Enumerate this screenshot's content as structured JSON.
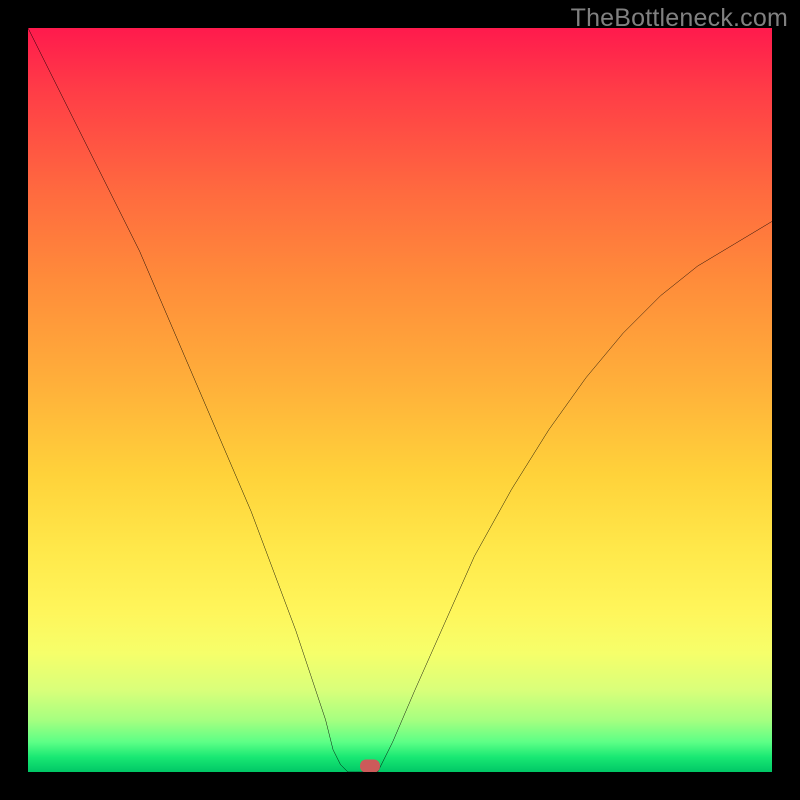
{
  "watermark": "TheBottleneck.com",
  "colors": {
    "frame_bg": "#000000",
    "watermark": "#808080",
    "curve_stroke": "#000000",
    "marker_fill": "#cc5a5a",
    "gradient_stops": [
      "#ff1a4d",
      "#ff3b47",
      "#ff6a3f",
      "#ff8c3a",
      "#ffb03a",
      "#ffd23a",
      "#ffe84a",
      "#fff55a",
      "#f6ff6a",
      "#d9ff7a",
      "#a6ff80",
      "#5cff86",
      "#19e873",
      "#00c766"
    ]
  },
  "chart_data": {
    "type": "line",
    "title": "",
    "xlabel": "",
    "ylabel": "",
    "xlim": [
      0,
      100
    ],
    "ylim": [
      0,
      100
    ],
    "grid": false,
    "legend": false,
    "series": [
      {
        "name": "left-branch",
        "x": [
          0,
          3,
          6,
          9,
          12,
          15,
          18,
          21,
          24,
          27,
          30,
          33,
          36,
          38,
          40,
          41,
          42,
          43
        ],
        "y": [
          100,
          94,
          88,
          82,
          76,
          70,
          63,
          56,
          49,
          42,
          35,
          27,
          19,
          13,
          7,
          3,
          1,
          0
        ]
      },
      {
        "name": "flat-min",
        "x": [
          43,
          44,
          45,
          46,
          47
        ],
        "y": [
          0,
          0,
          0,
          0,
          0
        ]
      },
      {
        "name": "right-branch",
        "x": [
          47,
          49,
          52,
          56,
          60,
          65,
          70,
          75,
          80,
          85,
          90,
          95,
          100
        ],
        "y": [
          0,
          4,
          11,
          20,
          29,
          38,
          46,
          53,
          59,
          64,
          68,
          71,
          74
        ]
      }
    ],
    "annotations": [
      {
        "name": "min-marker",
        "x": 46,
        "y": 0,
        "shape": "rounded-rect",
        "color": "#cc5a5a"
      }
    ]
  }
}
